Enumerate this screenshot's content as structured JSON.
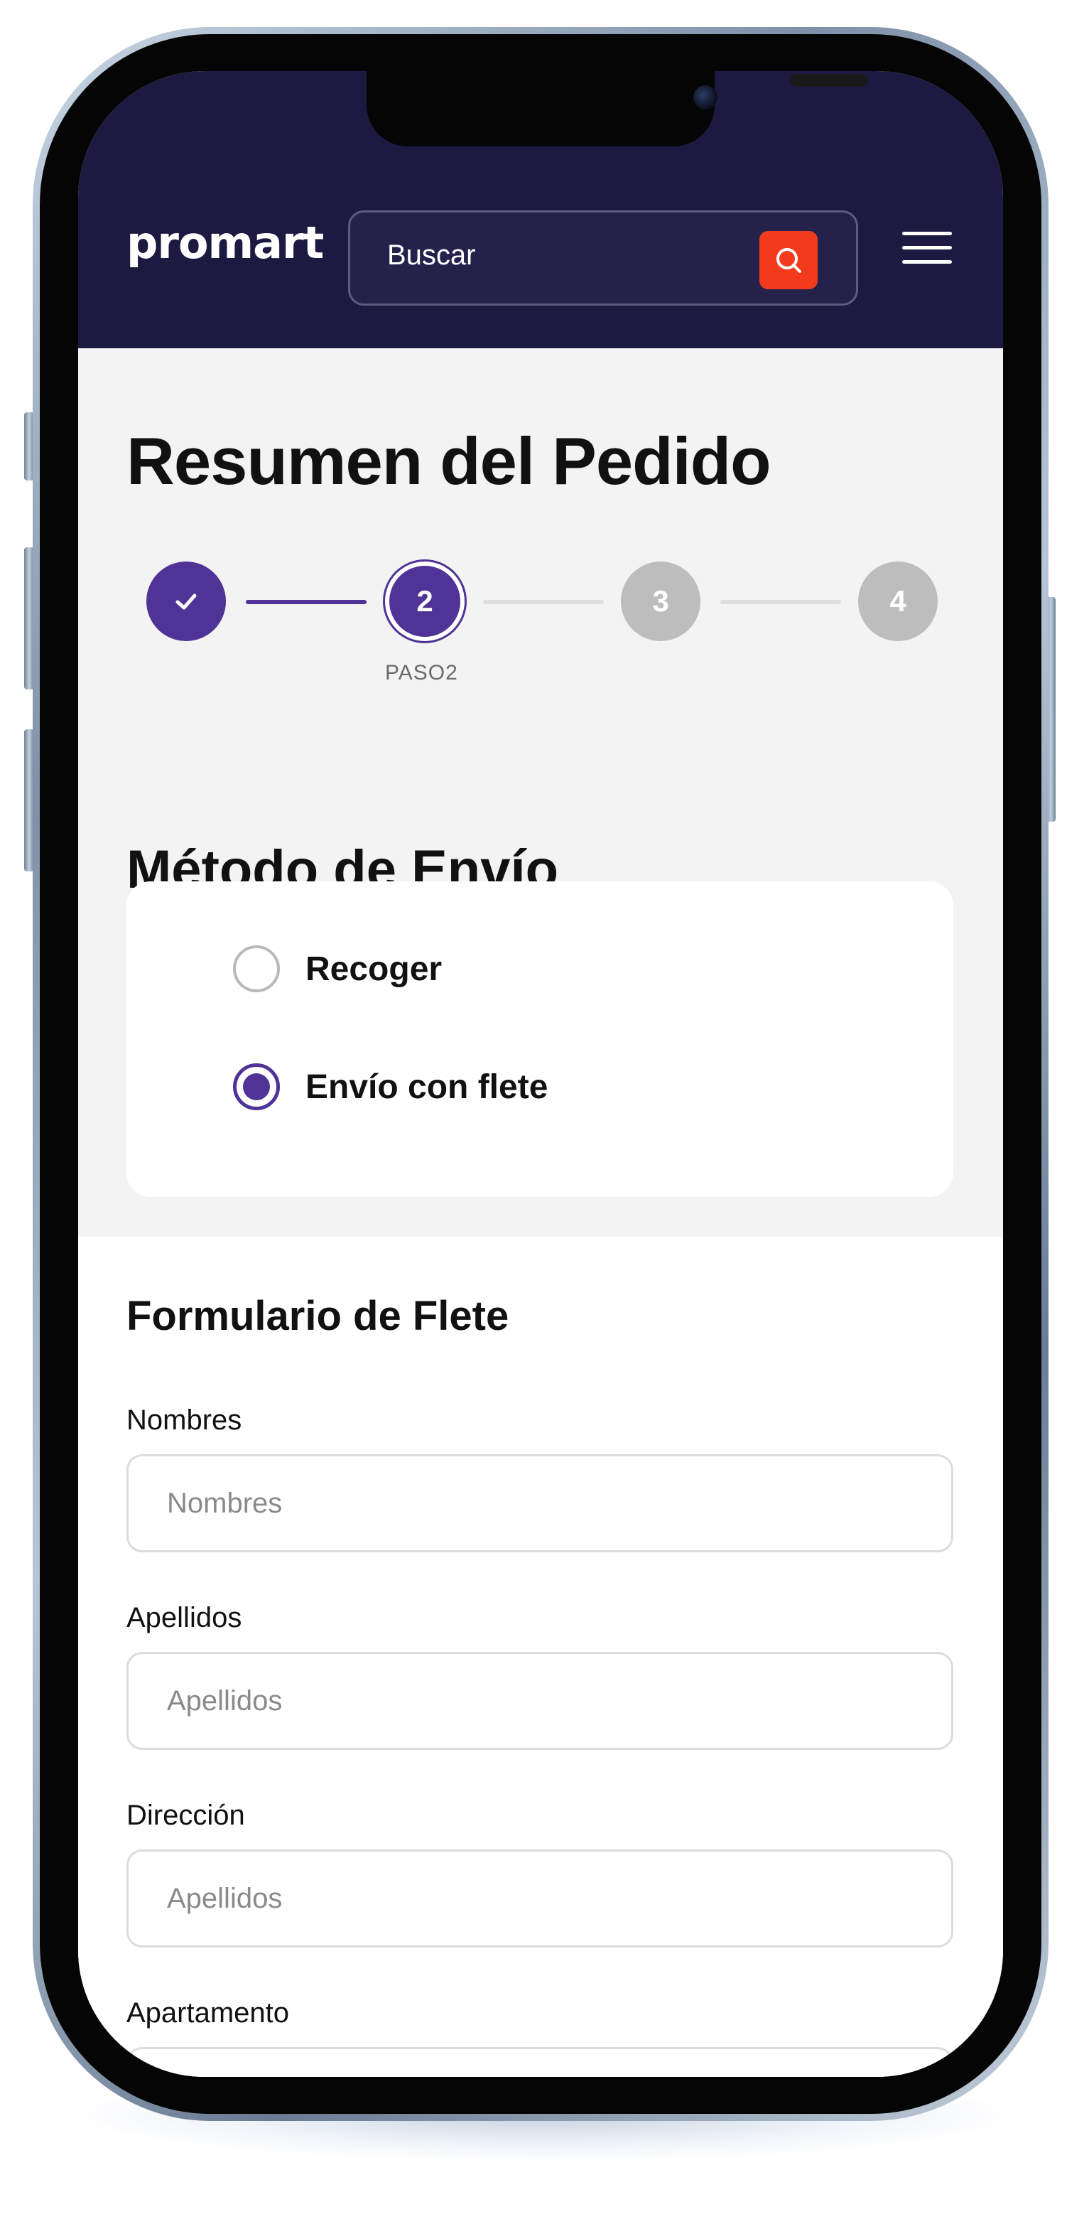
{
  "header": {
    "logo": "promart",
    "search_placeholder": "Buscar",
    "search_icon": "search-icon",
    "menu_icon": "hamburger-menu-icon"
  },
  "page_title": "Resumen del Pedido",
  "stepper": {
    "steps": [
      {
        "label": "✓",
        "state": "done"
      },
      {
        "label": "2",
        "state": "active",
        "caption": "PASO2"
      },
      {
        "label": "3",
        "state": "todo"
      },
      {
        "label": "4",
        "state": "todo"
      }
    ]
  },
  "shipping": {
    "title": "Método de Envío",
    "options": [
      {
        "label": "Recoger",
        "checked": false
      },
      {
        "label": "Envío con flete",
        "checked": true
      }
    ]
  },
  "form": {
    "title": "Formulario de Flete",
    "fields": [
      {
        "label": "Nombres",
        "placeholder": "Nombres"
      },
      {
        "label": "Apellidos",
        "placeholder": "Apellidos"
      },
      {
        "label": "Dirección",
        "placeholder": "Apellidos"
      },
      {
        "label": "Apartamento",
        "placeholder": ""
      }
    ]
  },
  "colors": {
    "header_bg": "#1c1a40",
    "accent_purple": "#503396",
    "search_button": "#f23a1c"
  }
}
